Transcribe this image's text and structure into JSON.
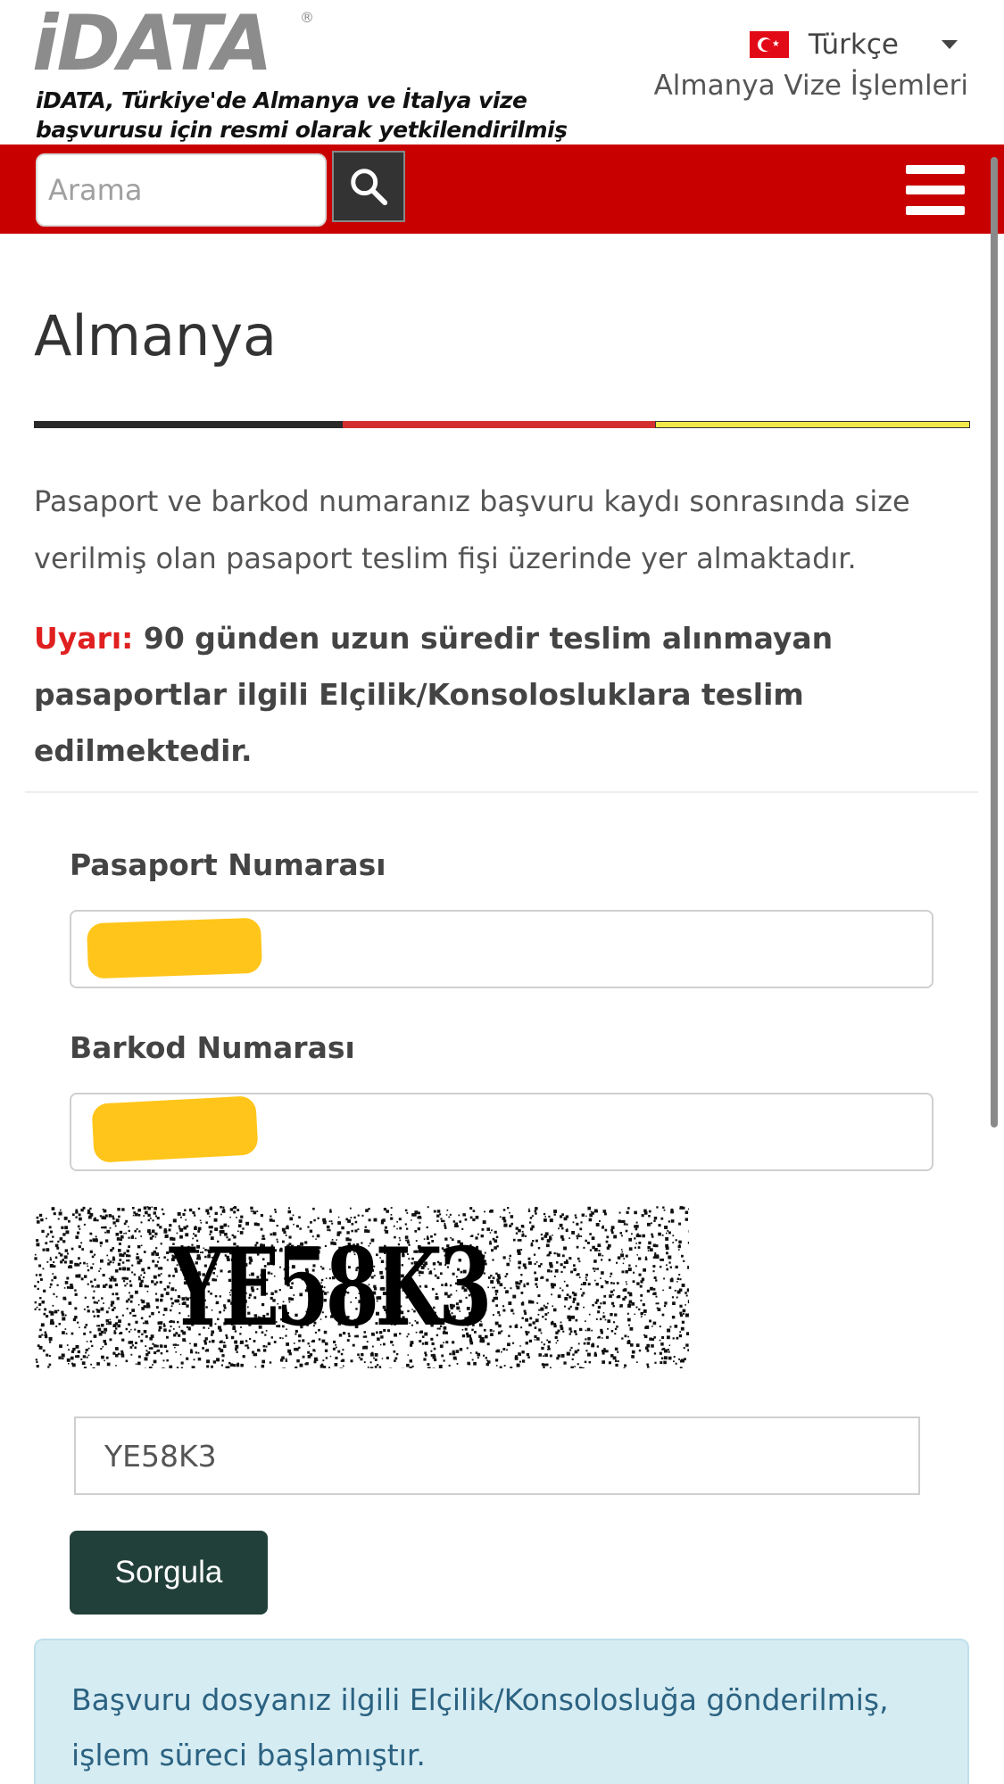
{
  "header": {
    "logo": "iDATA",
    "tagline": "iDATA, Türkiye'de Almanya ve İtalya vize başvurusu için resmi olarak yetkilendirilmiş",
    "language": "Türkçe",
    "subnav": "Almanya Vize İşlemleri"
  },
  "search": {
    "placeholder": "Arama"
  },
  "page": {
    "title": "Almanya",
    "info": "Pasaport ve barkod numaranız başvuru kaydı sonrasında size verilmiş olan pasaport teslim fişi üzerinde yer almaktadır.",
    "warning_label": "Uyarı:",
    "warning_text": "90 günden uzun süredir teslim alınmayan pasaportlar ilgili Elçilik/Konsolosluklara teslim edilmektedir."
  },
  "form": {
    "passport_label": "Pasaport Numarası",
    "barcode_label": "Barkod Numarası",
    "captcha_image_text": "YE58K3",
    "captcha_value": "YE58K3",
    "submit_label": "Sorgula"
  },
  "alert": {
    "message": "Başvuru dosyanız ilgili Elçilik/Konsolosluğa gönderilmiş, işlem süreci başlamıştır."
  },
  "colors": {
    "brand_red": "#c90000",
    "button_dark": "#22403a",
    "alert_bg": "#d6ecf3",
    "redaction": "#ffc20e"
  }
}
